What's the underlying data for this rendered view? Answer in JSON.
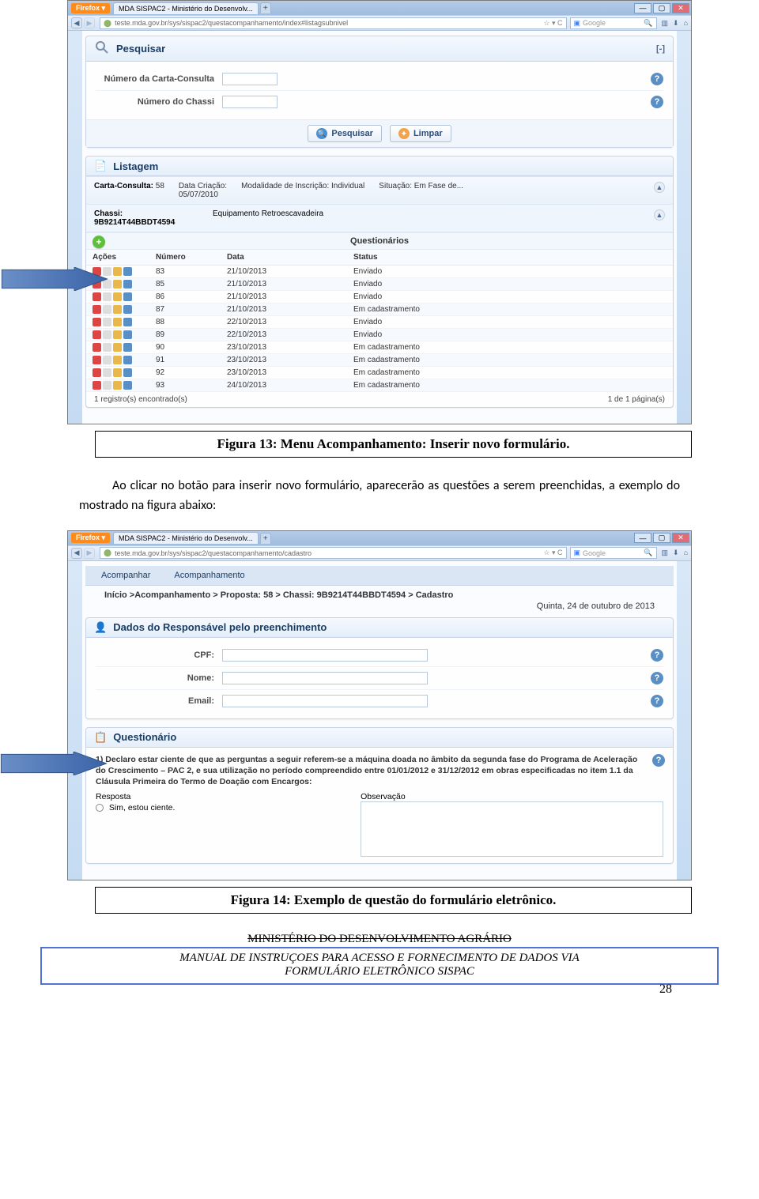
{
  "browser1": {
    "tab_title": "MDA SISPAC2 - Ministério do Desenvolv...",
    "url": "teste.mda.gov.br/sys/sispac2/questacompanhamento/index#listagsubnivel",
    "search_placeholder": "Google"
  },
  "pesquisar": {
    "title": "Pesquisar",
    "collapse": "[-]",
    "field_carta": "Número da Carta-Consulta",
    "field_chassi": "Número do Chassi",
    "btn_search": "Pesquisar",
    "btn_clear": "Limpar"
  },
  "listagem": {
    "title": "Listagem",
    "carta_label": "Carta-Consulta:",
    "carta_value": "58",
    "data_criacao_label": "Data Criação:",
    "data_criacao_value": "05/07/2010",
    "modalidade_label": "Modalidade de Inscrição:",
    "modalidade_value": "Individual",
    "situacao_label": "Situação:",
    "situacao_value": "Em Fase de...",
    "chassi_label": "Chassi:",
    "chassi_value": "9B9214T44BBDT4594",
    "equipamento": "Equipamento Retroescavadeira",
    "questionarios_header": "Questionários",
    "col_acoes": "Ações",
    "col_numero": "Número",
    "col_data": "Data",
    "col_status": "Status",
    "rows": [
      {
        "n": "83",
        "d": "21/10/2013",
        "s": "Enviado"
      },
      {
        "n": "85",
        "d": "21/10/2013",
        "s": "Enviado"
      },
      {
        "n": "86",
        "d": "21/10/2013",
        "s": "Enviado"
      },
      {
        "n": "87",
        "d": "21/10/2013",
        "s": "Em cadastramento"
      },
      {
        "n": "88",
        "d": "22/10/2013",
        "s": "Enviado"
      },
      {
        "n": "89",
        "d": "22/10/2013",
        "s": "Enviado"
      },
      {
        "n": "90",
        "d": "23/10/2013",
        "s": "Em cadastramento"
      },
      {
        "n": "91",
        "d": "23/10/2013",
        "s": "Em cadastramento"
      },
      {
        "n": "92",
        "d": "23/10/2013",
        "s": "Em cadastramento"
      },
      {
        "n": "93",
        "d": "24/10/2013",
        "s": "Em cadastramento"
      }
    ],
    "records_found": "1 registro(s) encontrado(s)",
    "page_info": "1 de 1 página(s)"
  },
  "caption1": "Figura 13: Menu Acompanhamento: Inserir novo formulário.",
  "paragraph": "Ao clicar no botão para inserir novo formulário, aparecerão as questões a serem preenchidas, a exemplo do mostrado na figura abaixo:",
  "browser2": {
    "tab_title": "MDA SISPAC2 - Ministério do Desenvolv...",
    "url": "teste.mda.gov.br/sys/sispac2/questacompanhamento/cadastro",
    "search_placeholder": "Google",
    "menu1": "Acompanhar",
    "menu2": "Acompanhamento",
    "breadcrumb": "Início >Acompanhamento > Proposta: 58 > Chassi: 9B9214T44BBDT4594 > Cadastro",
    "date": "Quinta, 24 de outubro de 2013"
  },
  "responsavel": {
    "title": "Dados do Responsável pelo preenchimento",
    "cpf_label": "CPF:",
    "nome_label": "Nome:",
    "email_label": "Email:"
  },
  "questionario": {
    "title": "Questionário",
    "question": "1) Declaro estar ciente de que as perguntas a seguir referem-se a máquina doada no âmbito da segunda fase do Programa de Aceleração do Crescimento – PAC 2, e sua utilização no período compreendido entre 01/01/2012 e 31/12/2012 em obras especificadas no item 1.1 da Cláusula Primeira do Termo de Doação com Encargos:",
    "resposta_label": "Resposta",
    "radio_label": "Sim, estou ciente.",
    "obs_label": "Observação"
  },
  "caption2": "Figura 14: Exemplo de questão do formulário eletrônico.",
  "footer": {
    "struck": "MINISTÉRIO DO DESENVOLVIMENTO AGRÁRIO",
    "line1": "MANUAL DE INSTRUÇOES PARA ACESSO E FORNECIMENTO DE DADOS VIA",
    "line2": "FORMULÁRIO ELETRÔNICO SISPAC"
  },
  "page_number": "28"
}
